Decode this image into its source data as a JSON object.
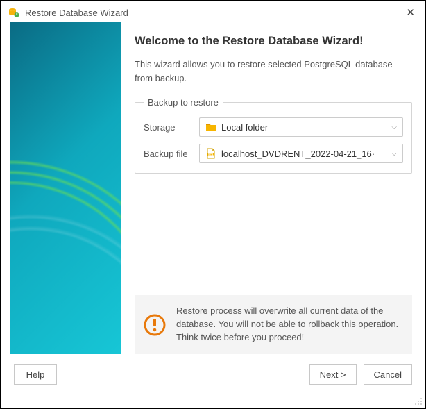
{
  "window": {
    "title": "Restore Database Wizard"
  },
  "main": {
    "heading": "Welcome to the Restore Database Wizard!",
    "intro": "This wizard allows you to restore selected PostgreSQL database from backup.",
    "fieldset_legend": "Backup to restore",
    "storage": {
      "label": "Storage",
      "value": "Local folder"
    },
    "backup_file": {
      "label": "Backup file",
      "value": "localhost_DVDRENT_2022-04-21_16·"
    },
    "warning": "Restore process will overwrite all current data of the database. You will not be able to rollback this operation. Think twice before you proceed!"
  },
  "footer": {
    "help": "Help",
    "next": "Next >",
    "cancel": "Cancel"
  }
}
